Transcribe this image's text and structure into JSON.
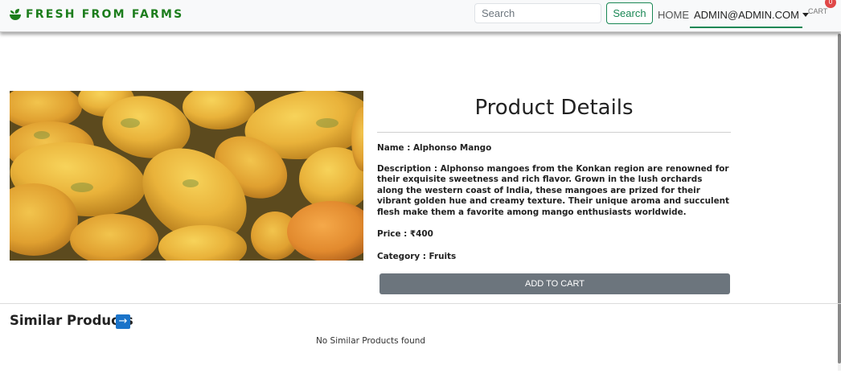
{
  "navbar": {
    "brand": "FRESH FROM FARMS",
    "search": {
      "placeholder": "Search",
      "value": ""
    },
    "search_button": "Search",
    "home": "HOME",
    "user": "ADMIN@ADMIN.COM",
    "cart": "CART",
    "cart_count": "0"
  },
  "product": {
    "heading": "Product Details",
    "name": "Name : Alphonso Mango",
    "description": "Description : Alphonso mangoes from the Konkan region are renowned for their exquisite sweetness and rich flavor. Grown in the lush orchards along the western coast of India, these mangoes are prized for their vibrant golden hue and creamy texture. Their unique aroma and succulent flesh make them a favorite among mango enthusiasts worldwide.",
    "price": "Price : ₹400",
    "category": "Category : Fruits",
    "add_to_cart": "ADD TO CART"
  },
  "similar": {
    "title": "Similar Products",
    "arrow": "→",
    "empty_message": "No Similar Products found"
  },
  "colors": {
    "brand": "#1c7d1c",
    "success": "#198754",
    "secondary": "#6c757d",
    "badge": "#e04848",
    "arrow": "#1a73c9"
  }
}
